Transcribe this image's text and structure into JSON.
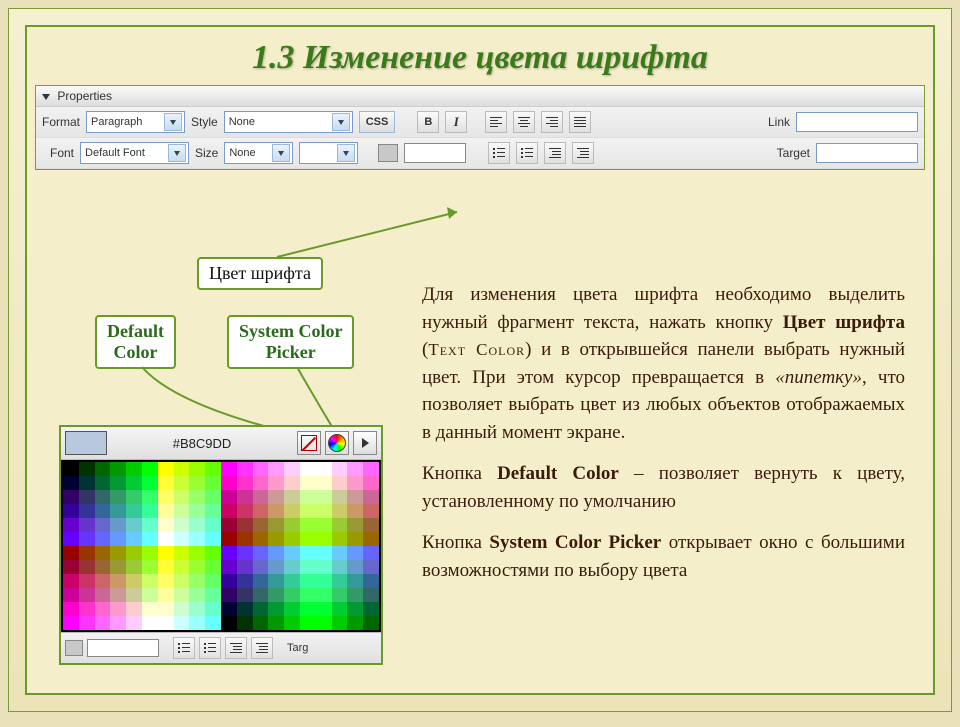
{
  "title": "1.3  Изменение цвета шрифта",
  "properties": {
    "panel_label": "Properties",
    "row1": {
      "format_label": "Format",
      "format_value": "Paragraph",
      "style_label": "Style",
      "style_value": "None",
      "css_button": "CSS",
      "link_label": "Link"
    },
    "row2": {
      "font_label": "Font",
      "font_value": "Default Font",
      "size_label": "Size",
      "size_value": "None",
      "target_label": "Target"
    }
  },
  "callouts": {
    "text_color": "Цвет шрифта",
    "default_color": "Default\nColor",
    "system_picker": "System Color\nPicker"
  },
  "picker": {
    "hex": "#B8C9DD",
    "swatch_color": "#B8C9DD",
    "bottom_targ": "Targ"
  },
  "body": {
    "p1_a": "Для изменения цвета шрифта необходимо выделить нужный фрагмент текста, нажать кнопку ",
    "p1_bold": "Цвет шрифта",
    "p1_b": " (",
    "p1_eng": "Text Color",
    "p1_c": ") и в открывшейся панели выбрать нужный цвет. При этом курсор превращается в ",
    "p1_ital": "«пипетку»",
    "p1_d": ", что позволяет выбрать цвет из любых объектов отображаемых в данный момент экране.",
    "p2_a": "Кнопка ",
    "p2_bold": "Default Color",
    "p2_b": " – позволяет вернуть к цвету, установленному по умолчанию",
    "p3_a": "Кнопка ",
    "p3_bold": "System Color Picker",
    "p3_b": " открывает окно с большими возможностями по выбору цвета"
  }
}
